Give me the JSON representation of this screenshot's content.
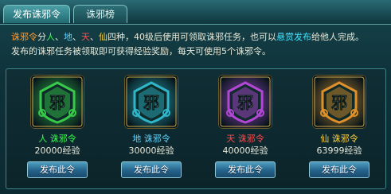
{
  "tabs": [
    {
      "label": "发布诛邪令"
    },
    {
      "label": "诛邪榜"
    }
  ],
  "description": {
    "line1": {
      "p1": "诛邪令",
      "p2": "分",
      "t1": "人",
      "s1": "、",
      "t2": "地",
      "s2": "、",
      "t3": "天",
      "s3": "、",
      "t4": "仙",
      "p3": "四种，40级后使用可领取诛邪任务，也可以",
      "p4": "悬赏发布",
      "p5": "给他人完成。"
    },
    "line2": "发布的诛邪任务被领取即可获得经验奖励，每天可使用5个诛邪令。"
  },
  "cards": [
    {
      "name": "人 诛邪令",
      "exp": "20000经验",
      "button": "发布此令",
      "name_color": "#35ff4f",
      "icon_color": "#38c94a",
      "icon": "shield-rune-icon"
    },
    {
      "name": "地 诛邪令",
      "exp": "30000经验",
      "button": "发布此令",
      "name_color": "#5fd5ff",
      "icon_color": "#2fb7c9",
      "icon": "shield-rune-icon"
    },
    {
      "name": "天 诛邪令",
      "exp": "40000经验",
      "button": "发布此令",
      "name_color": "#ff4b4b",
      "icon_color": "#b348d6",
      "icon": "shield-rune-icon"
    },
    {
      "name": "仙 诛邪令",
      "exp": "63999经验",
      "button": "发布此令",
      "name_color": "#ffd23a",
      "icon_color": "#e0902a",
      "icon": "shield-rune-icon"
    }
  ],
  "icon_glyph": "邪"
}
